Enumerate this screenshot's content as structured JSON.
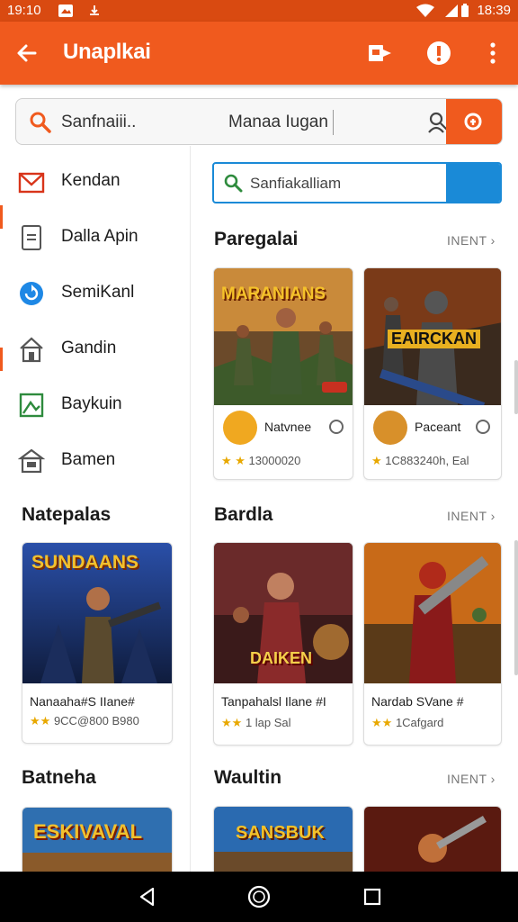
{
  "status_bar": {
    "time_left": "19:10",
    "time_right": "18:39",
    "icons": [
      "image-icon",
      "notification-icon",
      "wifi-icon",
      "sim-icon"
    ]
  },
  "app_bar": {
    "title": "Unaplkai",
    "icons": [
      "back-arrow-icon",
      "cast-icon",
      "info-icon",
      "more-vert-icon"
    ],
    "color": "#f05a1e"
  },
  "top_search": {
    "placeholder": "Sanfnaiii..",
    "value": "Manaa Iugan",
    "icons": [
      "search-icon",
      "person-icon",
      "search-go-icon"
    ]
  },
  "drawer": {
    "items": [
      {
        "label": "Kendan",
        "icon": "mail-icon"
      },
      {
        "label": "Dalla Apin",
        "icon": "document-icon"
      },
      {
        "label": "SemiKanl",
        "icon": "sync-icon"
      },
      {
        "label": "Gandin",
        "icon": "house-icon"
      },
      {
        "label": "Baykuin",
        "icon": "image-frame-icon"
      },
      {
        "label": "Bamen",
        "icon": "store-icon"
      }
    ],
    "sections": [
      {
        "title": "Natepalas",
        "card": {
          "name": "Nanaaha#S IIane#",
          "rating": "★★",
          "meta": "9CC@800 B980",
          "art_title": "SUNDAANS"
        }
      },
      {
        "title": "Batneha",
        "card": {
          "art_title": "ESKIVAVAL"
        }
      }
    ]
  },
  "main": {
    "search_placeholder": "Sanfiakalliam",
    "sections": [
      {
        "title": "Paregalai",
        "see_all": "INENT",
        "cards": [
          {
            "art_title": "MARANIANS",
            "name": "Natvnee",
            "rating": "★ ★",
            "meta": "13000020"
          },
          {
            "art_title": "EAIRCKAN",
            "name": "Paceant",
            "rating": "★",
            "meta": "1C883240h, Eal"
          }
        ]
      },
      {
        "title": "Bardla",
        "see_all": "INENT",
        "cards": [
          {
            "art_title": "DAIKEN",
            "name": "Tanpahalsl Ilane #I",
            "rating": "★★",
            "meta": "1 lap Sal"
          },
          {
            "art_title": "",
            "name": "Nardab SVane #",
            "rating": "★★",
            "meta": "1Cafgard"
          }
        ]
      },
      {
        "title": "Waultin",
        "see_all": "INENT",
        "cards": [
          {
            "art_title": "SANSBUK"
          },
          {
            "art_title": ""
          }
        ]
      }
    ]
  },
  "nav_bar": {
    "icons": [
      "back-triangle-icon",
      "home-circle-icon",
      "recents-square-icon"
    ]
  }
}
